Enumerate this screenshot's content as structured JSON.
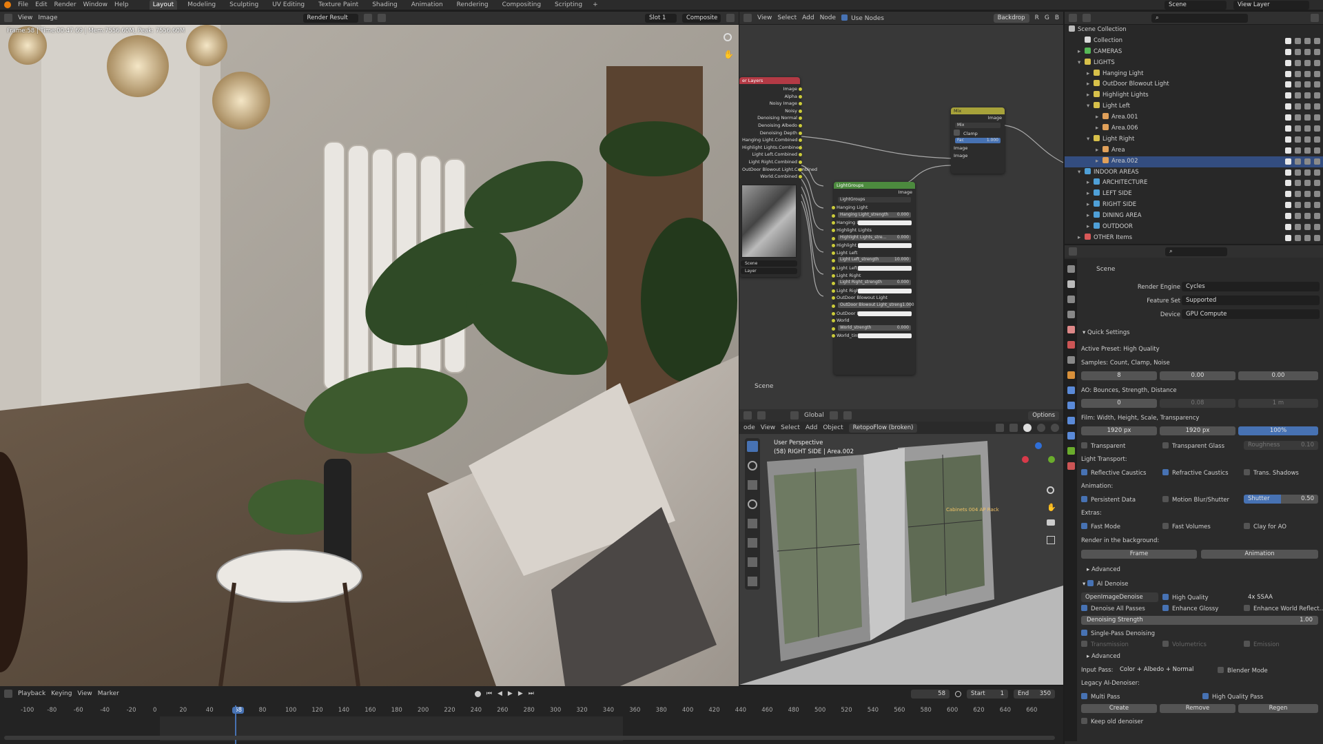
{
  "topmenu": {
    "items": [
      "File",
      "Edit",
      "Render",
      "Window",
      "Help"
    ],
    "workspaces": [
      "Layout",
      "Modeling",
      "Sculpting",
      "UV Editing",
      "Texture Paint",
      "Shading",
      "Animation",
      "Rendering",
      "Compositing",
      "Scripting"
    ],
    "scene": "Scene",
    "view_layer": "View Layer"
  },
  "image_editor": {
    "menus": [
      "View",
      "Image"
    ],
    "image_name": "Render Result",
    "slot": "Slot 1",
    "pass": "Composite",
    "info": "Frame:58 | Time:00:47.69 | Mem:7556.60M, Peak: 7556.60M"
  },
  "node_editor": {
    "menus": [
      "View",
      "Select",
      "Add",
      "Node"
    ],
    "use_nodes": "Use Nodes",
    "backdrop": "Backdrop",
    "channels": [
      "R",
      "G",
      "B"
    ],
    "scene_label": "Scene",
    "render_layers": {
      "title": "er Layers",
      "outputs": [
        "Image",
        "Alpha",
        "Noisy Image",
        "Noisy",
        "Denoising Normal",
        "Denoising Albedo",
        "Denoising Depth",
        "Hanging Light.Combined",
        "Highlight Lights.Combined",
        "Light Left.Combined",
        "Light Right.Combined",
        "OutDoor Blowout Light.Combined",
        "World.Combined"
      ],
      "scene": "Scene",
      "layer": "Layer"
    },
    "lightgroups": {
      "title": "LightGroups",
      "output": "Image",
      "group": "LightGroups",
      "rows": [
        {
          "type": "label",
          "text": "Hanging Light"
        },
        {
          "type": "slider",
          "text": "Hanging Light_strength",
          "value": "0.000"
        },
        {
          "type": "color",
          "text": "Hanging Light..."
        },
        {
          "type": "label",
          "text": "Highlight Lights"
        },
        {
          "type": "slider",
          "text": "Highlight Lights_stre...",
          "value": "0.000"
        },
        {
          "type": "color",
          "text": "Highlight Light..."
        },
        {
          "type": "label",
          "text": "Light Left"
        },
        {
          "type": "slider",
          "text": "Light Left_strength",
          "value": "10.000"
        },
        {
          "type": "color",
          "text": "Light Left_tint"
        },
        {
          "type": "label",
          "text": "Light Right"
        },
        {
          "type": "slider",
          "text": "Light Right_strength",
          "value": "0.000"
        },
        {
          "type": "color",
          "text": "Light Right_tint"
        },
        {
          "type": "label",
          "text": "OutDoor Blowout Light"
        },
        {
          "type": "slider",
          "text": "OutDoor Blowout Light_streng",
          "value": "1.000"
        },
        {
          "type": "color",
          "text": "OutDoor Blow..."
        },
        {
          "type": "label",
          "text": "World"
        },
        {
          "type": "slider",
          "text": "World_strength",
          "value": "0.000"
        },
        {
          "type": "color",
          "text": "World_tint"
        }
      ]
    },
    "mix": {
      "title": "Mix",
      "output": "Image",
      "mode": "Mix",
      "clamp": "Clamp",
      "fac_label": "Fac",
      "fac_value": "1.000",
      "inputs": [
        "Image",
        "Image"
      ]
    }
  },
  "viewport3d": {
    "menus": [
      "View",
      "Select",
      "Add",
      "Object"
    ],
    "mode": "ode",
    "addon": "RetopoFlow (broken)",
    "orientation": "Global",
    "options": "Options",
    "line1": "User Perspective",
    "line2": "(58) RIGHT SIDE | Area.002",
    "obj_label": "Cabinets 004 AP Rack"
  },
  "outliner": {
    "title": "Scene Collection",
    "rows": [
      {
        "depth": 1,
        "label": "Collection",
        "color": "#d9d9d9",
        "expanded": null
      },
      {
        "depth": 1,
        "label": "CAMERAS",
        "color": "#57b957",
        "expanded": false
      },
      {
        "depth": 1,
        "label": "LIGHTS",
        "color": "#d7c04a",
        "expanded": true
      },
      {
        "depth": 2,
        "label": "Hanging Light",
        "color": "#d7c04a",
        "expanded": false
      },
      {
        "depth": 2,
        "label": "OutDoor Blowout Light",
        "color": "#d7c04a",
        "expanded": false
      },
      {
        "depth": 2,
        "label": "Highlight Lights",
        "color": "#d7c04a",
        "expanded": false
      },
      {
        "depth": 2,
        "label": "Light Left",
        "color": "#d7c04a",
        "expanded": true
      },
      {
        "depth": 3,
        "label": "Area.001",
        "color": "#e0a05a",
        "expanded": false
      },
      {
        "depth": 3,
        "label": "Area.006",
        "color": "#e0a05a",
        "expanded": false
      },
      {
        "depth": 2,
        "label": "Light Right",
        "color": "#d7c04a",
        "expanded": true
      },
      {
        "depth": 3,
        "label": "Area",
        "color": "#e0a05a",
        "expanded": false
      },
      {
        "depth": 3,
        "label": "Area.002",
        "color": "#e0a05a",
        "expanded": false,
        "selected": true
      },
      {
        "depth": 1,
        "label": "INDOOR AREAS",
        "color": "#4fa0d8",
        "expanded": true
      },
      {
        "depth": 2,
        "label": "ARCHITECTURE",
        "color": "#4fa0d8",
        "expanded": false
      },
      {
        "depth": 2,
        "label": "LEFT SIDE",
        "color": "#4fa0d8",
        "expanded": false
      },
      {
        "depth": 2,
        "label": "RIGHT SIDE",
        "color": "#4fa0d8",
        "expanded": false
      },
      {
        "depth": 2,
        "label": "DINING AREA",
        "color": "#4fa0d8",
        "expanded": false
      },
      {
        "depth": 2,
        "label": "OUTDOOR",
        "color": "#4fa0d8",
        "expanded": false
      },
      {
        "depth": 1,
        "label": "OTHER Items",
        "color": "#d85858",
        "expanded": false
      }
    ]
  },
  "properties": {
    "scene": "Scene",
    "render_engine_label": "Render Engine",
    "render_engine": "Cycles",
    "feature_set_label": "Feature Set",
    "feature_set": "Supported",
    "device_label": "Device",
    "device": "GPU Compute",
    "quick_settings": "Quick Settings",
    "preset": "Active Preset: High Quality",
    "samples_label": "Samples: Count, Clamp, Noise",
    "samples": [
      "8",
      "0.00",
      "0.00"
    ],
    "ao_label": "AO: Bounces, Strength, Distance",
    "ao": [
      "0",
      "0.08",
      "1 m"
    ],
    "film_label": "Film: Width, Height, Scale, Transparency",
    "film": [
      "1920 px",
      "1920 px",
      "100%"
    ],
    "transparent": "Transparent",
    "transparent_glass": "Transparent Glass",
    "roughness_label": "Roughness",
    "roughness": "0.10",
    "light_transport": "Light Transport:",
    "reflective": "Reflective Caustics",
    "refractive": "Refractive Caustics",
    "trans_shadows": "Trans. Shadows",
    "animation": "Animation:",
    "persistent": "Persistent Data",
    "motion_blur": "Motion Blur/Shutter",
    "shutter_label": "Shutter",
    "shutter": "0.50",
    "extras": "Extras:",
    "fast_mode": "Fast Mode",
    "fast_volumes": "Fast Volumes",
    "clay": "Clay for AO",
    "render_bg": "Render in the background:",
    "frame_btn": "Frame",
    "animation_btn": "Animation",
    "advanced": "Advanced",
    "ai_denoise": "AI Denoise",
    "denoiser": "OpenImageDenoise",
    "high_quality": "High Quality",
    "ssaa": "4x SSAA",
    "denoise_all": "Denoise All Passes",
    "enhance_glossy": "Enhance Glossy",
    "enhance_world": "Enhance World Reflect...",
    "strength_label": "Denoising Strength",
    "strength": "1.00",
    "single_pass": "Single-Pass Denoising",
    "transmission": "Transmission",
    "volumetrics": "Volumetrics",
    "emission": "Emission",
    "advanced2": "Advanced",
    "input_pass_label": "Input Pass:",
    "input_pass": "Color + Albedo + Normal",
    "blender_mode": "Blender Mode",
    "legacy": "Legacy AI-Denoiser:",
    "multi_pass": "Multi Pass",
    "hq_pass": "High Quality Pass",
    "create": "Create",
    "remove": "Remove",
    "regen": "Regen",
    "keep_old": "Keep old denoiser"
  },
  "timeline": {
    "menus": [
      "Playback",
      "Keying",
      "View",
      "Marker"
    ],
    "current": "58",
    "start_label": "Start",
    "start": "1",
    "end_label": "End",
    "end": "350",
    "ticks": [
      "-100",
      "-80",
      "-60",
      "-40",
      "-20",
      "0",
      "20",
      "40",
      "58",
      "80",
      "100",
      "120",
      "140",
      "160",
      "180",
      "200",
      "220",
      "240",
      "260",
      "280",
      "300",
      "320",
      "340",
      "360",
      "380",
      "400",
      "420",
      "440",
      "460",
      "480",
      "500",
      "520",
      "540",
      "560",
      "580",
      "600",
      "620",
      "640",
      "660"
    ]
  }
}
